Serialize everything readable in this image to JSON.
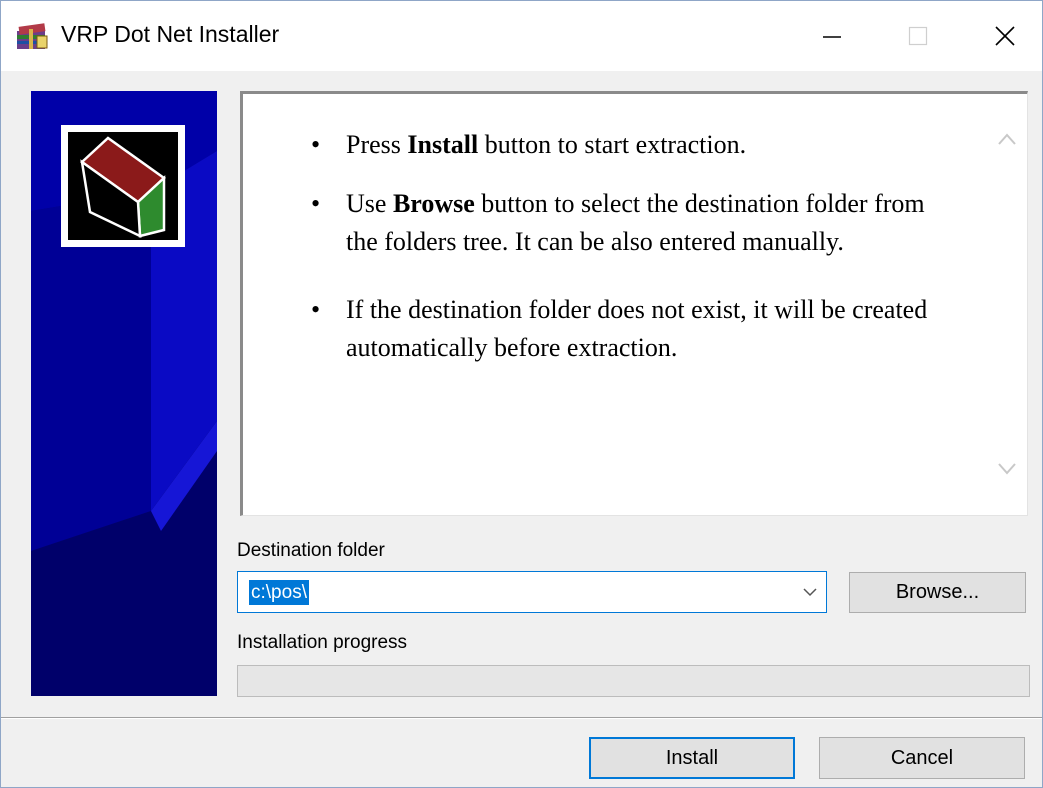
{
  "window": {
    "title": "VRP Dot Net Installer",
    "controls": {
      "minimize_icon": "minimize-icon",
      "maximize_icon": "maximize-icon",
      "close_icon": "close-icon"
    }
  },
  "instructions": {
    "items": [
      {
        "before": "Press ",
        "bold": "Install",
        "after": " button to start extraction."
      },
      {
        "before": "Use ",
        "bold": "Browse",
        "after": " button to select the destination folder from the folders tree. It can be also entered manually."
      },
      {
        "before": "If the destination folder does not exist, it will be created automatically before extraction.",
        "bold": "",
        "after": ""
      }
    ]
  },
  "destination": {
    "label": "Destination folder",
    "value": "c:\\pos\\",
    "browse_label": "Browse..."
  },
  "progress": {
    "label": "Installation progress",
    "value": 0
  },
  "footer": {
    "install_label": "Install",
    "cancel_label": "Cancel"
  },
  "colors": {
    "accent": "#0078d7",
    "banner_dark": "#000080",
    "banner_mid": "#0a0ab8"
  }
}
